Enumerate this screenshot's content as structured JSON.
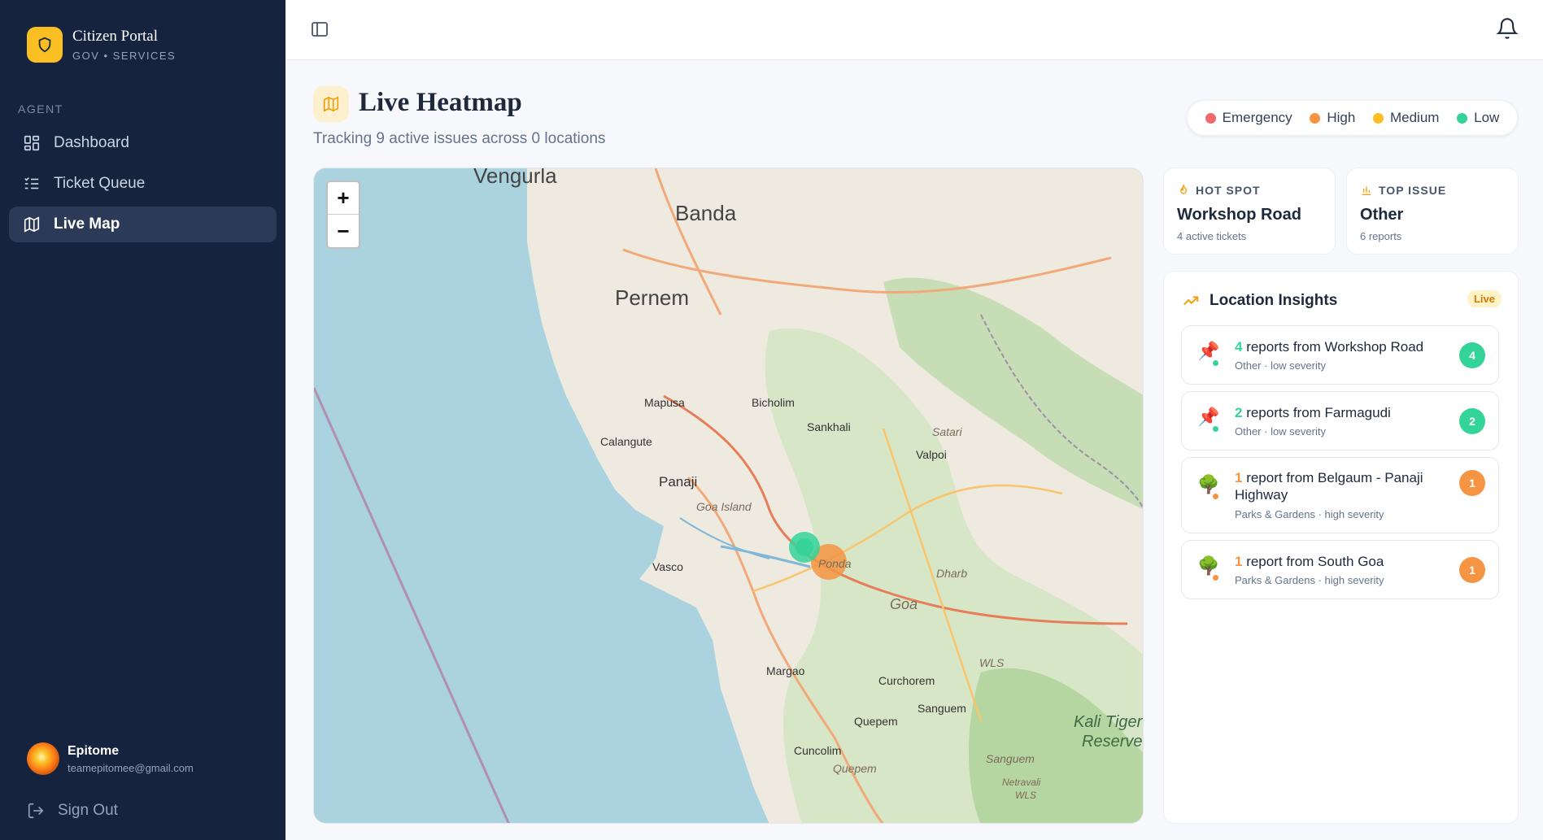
{
  "brand": {
    "title": "Citizen Portal",
    "subtitle": "GOV • SERVICES"
  },
  "sidebar": {
    "section_label": "AGENT",
    "items": [
      {
        "label": "Dashboard",
        "icon": "dashboard-icon"
      },
      {
        "label": "Ticket Queue",
        "icon": "list-icon"
      },
      {
        "label": "Live Map",
        "icon": "map-icon",
        "active": true
      }
    ],
    "user": {
      "name": "Epitome",
      "email": "teamepitomee@gmail.com"
    },
    "signout_label": "Sign Out"
  },
  "header": {
    "title": "Live Heatmap",
    "subtitle": "Tracking 9 active issues across 0 locations"
  },
  "legend": [
    {
      "label": "Emergency",
      "color": "#ef6b6b"
    },
    {
      "label": "High",
      "color": "#f59442"
    },
    {
      "label": "Medium",
      "color": "#fbbf24"
    },
    {
      "label": "Low",
      "color": "#34d399"
    }
  ],
  "map": {
    "zoom_in": "+",
    "zoom_out": "−",
    "places": {
      "vengurla": "Vengurla",
      "banda": "Banda",
      "pernem": "Pernem",
      "mapusa": "Mapusa",
      "bicholim": "Bicholim",
      "sankhali": "Sankhali",
      "satari": "Satari",
      "valpoi": "Valpoi",
      "calangute": "Calangute",
      "panaji": "Panaji",
      "goa_island": "Goa Island",
      "vasco": "Vasco",
      "ponda": "Ponda",
      "dharb": "Dharb",
      "goa": "Goa",
      "wls": "WLS",
      "margao": "Margao",
      "curchorem": "Curchorem",
      "sanguem": "Sanguem",
      "quepem": "Quepem",
      "quepem2": "Quepem",
      "cuncolim": "Cuncolim",
      "kali": "Kali Tiger",
      "reserve": "Reserve",
      "sanguem2": "Sanguem",
      "netravali": "Netravali",
      "wls2": "WLS"
    }
  },
  "hotspot": {
    "label": "HOT SPOT",
    "value": "Workshop Road",
    "sub": "4 active tickets"
  },
  "top_issue": {
    "label": "TOP ISSUE",
    "value": "Other",
    "sub": "6 reports"
  },
  "insights": {
    "title": "Location Insights",
    "badge": "Live",
    "items": [
      {
        "count": "4",
        "text": " reports from Workshop Road",
        "meta": "Other · low severity",
        "badge": "4",
        "icon": "pushpin-icon",
        "color": "#34d399"
      },
      {
        "count": "2",
        "text": " reports from Farmagudi",
        "meta": "Other · low severity",
        "badge": "2",
        "icon": "pushpin-icon",
        "color": "#34d399"
      },
      {
        "count": "1",
        "text": " report from Belgaum - Panaji Highway",
        "meta": "Parks & Gardens · high severity",
        "badge": "1",
        "icon": "tree-icon",
        "color": "#f59442"
      },
      {
        "count": "1",
        "text": " report from South Goa",
        "meta": "Parks & Gardens · high severity",
        "badge": "1",
        "icon": "tree-icon",
        "color": "#f59442"
      }
    ]
  }
}
